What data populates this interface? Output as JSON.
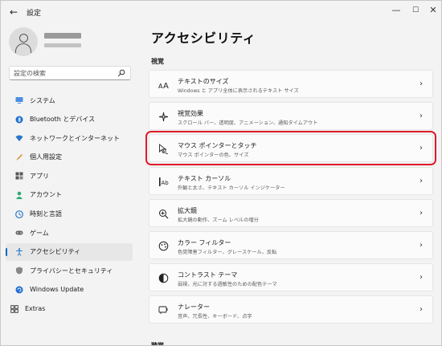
{
  "window": {
    "title": "設定",
    "back_glyph": "←",
    "min_glyph": "—",
    "max_glyph": "☐",
    "close_glyph": "✕"
  },
  "sidebar": {
    "search": {
      "placeholder": "設定の検索"
    },
    "items": [
      {
        "label": "システム",
        "icon": "system-icon",
        "color": "#3a7bd5"
      },
      {
        "label": "Bluetooth とデバイス",
        "icon": "bluetooth-icon",
        "color": "#1f6fd1"
      },
      {
        "label": "ネットワークとインターネット",
        "icon": "network-icon",
        "color": "#2a76c9"
      },
      {
        "label": "個人用設定",
        "icon": "personalization-icon",
        "color": "#d68b2a"
      },
      {
        "label": "アプリ",
        "icon": "apps-icon",
        "color": "#555555"
      },
      {
        "label": "アカウント",
        "icon": "account-icon",
        "color": "#2aa876"
      },
      {
        "label": "時刻と言語",
        "icon": "time-language-icon",
        "color": "#2a76c9"
      },
      {
        "label": "ゲーム",
        "icon": "gaming-icon",
        "color": "#666666"
      },
      {
        "label": "アクセシビリティ",
        "icon": "accessibility-icon",
        "color": "#2a76c9",
        "active": true
      },
      {
        "label": "プライバシーとセキュリティ",
        "icon": "shield-icon",
        "color": "#777777"
      },
      {
        "label": "Windows Update",
        "icon": "windows-update-icon",
        "color": "#1f6fd1"
      },
      {
        "label": "Extras",
        "icon": "extras-icon",
        "color": "#333333"
      }
    ]
  },
  "main": {
    "title": "アクセシビリティ",
    "section_vision": "視覚",
    "section_hearing": "聴覚",
    "cards": [
      {
        "title": "テキストのサイズ",
        "subtitle": "Windows と アプリ全体に表示されるテキスト サイズ",
        "icon": "text-size-icon"
      },
      {
        "title": "視覚効果",
        "subtitle": "スクロール バー、透明度、アニメーション、通知タイムアウト",
        "icon": "visual-effects-icon"
      },
      {
        "title": "マウス ポインターとタッチ",
        "subtitle": "マウス ポインターの色、サイズ",
        "icon": "mouse-pointer-icon",
        "selected": true
      },
      {
        "title": "テキスト カーソル",
        "subtitle": "外観と太さ、テキスト カーソル インジケーター",
        "icon": "text-cursor-icon"
      },
      {
        "title": "拡大鏡",
        "subtitle": "拡大鏡の動作、ズーム レベルの増分",
        "icon": "magnifier-icon"
      },
      {
        "title": "カラー フィルター",
        "subtitle": "色覚障害フィルター、グレースケール、反転",
        "icon": "color-filter-icon"
      },
      {
        "title": "コントラスト テーマ",
        "subtitle": "弱視、光に対する過敏性のための配色テーマ",
        "icon": "contrast-theme-icon"
      },
      {
        "title": "ナレーター",
        "subtitle": "音声、冗長性、キーボード、点字",
        "icon": "narrator-icon"
      }
    ],
    "chevron": "›"
  },
  "colors": {
    "accent": "#0067c0",
    "highlight": "#e01a2a"
  }
}
